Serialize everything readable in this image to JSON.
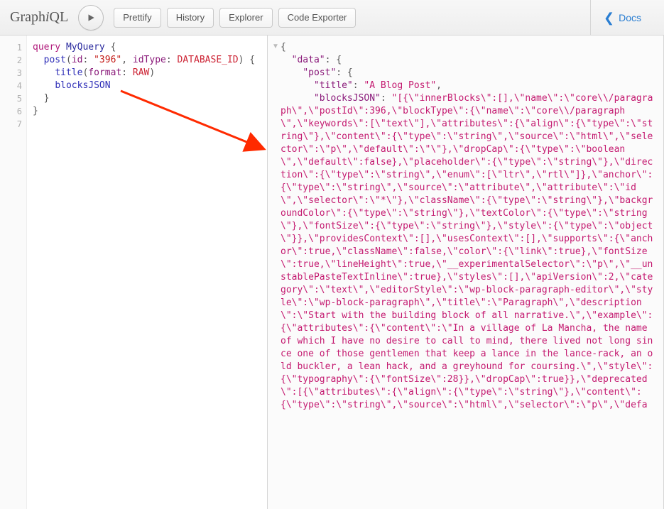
{
  "brand": {
    "pre": "Graph",
    "mid": "i",
    "post": "QL"
  },
  "toolbar": {
    "prettify": "Prettify",
    "history": "History",
    "explorer": "Explorer",
    "exporter": "Code Exporter"
  },
  "docs": {
    "label": "Docs"
  },
  "gutter": [
    "1",
    "2",
    "3",
    "4",
    "5",
    "6",
    "7"
  ],
  "query": {
    "kw": "query",
    "op": "MyQuery",
    "l1_open": " {",
    "l2_field": "post",
    "l2_arg1_name": "id",
    "l2_arg1_val": "\"396\"",
    "l2_arg2_name": "idType",
    "l2_arg2_val": "DATABASE_ID",
    "l2_close": ") {",
    "l3_field": "title",
    "l3_arg_name": "format",
    "l3_arg_val": "RAW",
    "l4_field": "blocksJSON",
    "l5": "  }",
    "l6": "}"
  },
  "result": {
    "open": "{",
    "data_key": "\"data\"",
    "post_key": "\"post\"",
    "title_key": "\"title\"",
    "title_val": "\"A Blog Post\"",
    "blocks_key": "\"blocksJSON\"",
    "blocks_val": "\"[{\\\"innerBlocks\\\":[],\\\"name\\\":\\\"core\\\\/paragraph\\\",\\\"postId\\\":396,\\\"blockType\\\":{\\\"name\\\":\\\"core\\\\/paragraph\\\",\\\"keywords\\\":[\\\"text\\\"],\\\"attributes\\\":{\\\"align\\\":{\\\"type\\\":\\\"string\\\"},\\\"content\\\":{\\\"type\\\":\\\"string\\\",\\\"source\\\":\\\"html\\\",\\\"selector\\\":\\\"p\\\",\\\"default\\\":\\\"\\\"},\\\"dropCap\\\":{\\\"type\\\":\\\"boolean\\\",\\\"default\\\":false},\\\"placeholder\\\":{\\\"type\\\":\\\"string\\\"},\\\"direction\\\":{\\\"type\\\":\\\"string\\\",\\\"enum\\\":[\\\"ltr\\\",\\\"rtl\\\"]},\\\"anchor\\\":{\\\"type\\\":\\\"string\\\",\\\"source\\\":\\\"attribute\\\",\\\"attribute\\\":\\\"id\\\",\\\"selector\\\":\\\"*\\\"},\\\"className\\\":{\\\"type\\\":\\\"string\\\"},\\\"backgroundColor\\\":{\\\"type\\\":\\\"string\\\"},\\\"textColor\\\":{\\\"type\\\":\\\"string\\\"},\\\"fontSize\\\":{\\\"type\\\":\\\"string\\\"},\\\"style\\\":{\\\"type\\\":\\\"object\\\"}},\\\"providesContext\\\":[],\\\"usesContext\\\":[],\\\"supports\\\":{\\\"anchor\\\":true,\\\"className\\\":false,\\\"color\\\":{\\\"link\\\":true},\\\"fontSize\\\":true,\\\"lineHeight\\\":true,\\\"__experimentalSelector\\\":\\\"p\\\",\\\"__unstablePasteTextInline\\\":true},\\\"styles\\\":[],\\\"apiVersion\\\":2,\\\"category\\\":\\\"text\\\",\\\"editorStyle\\\":\\\"wp-block-paragraph-editor\\\",\\\"style\\\":\\\"wp-block-paragraph\\\",\\\"title\\\":\\\"Paragraph\\\",\\\"description\\\":\\\"Start with the building block of all narrative.\\\",\\\"example\\\":{\\\"attributes\\\":{\\\"content\\\":\\\"In a village of La Mancha, the name of which I have no desire to call to mind, there lived not long since one of those gentlemen that keep a lance in the lance-rack, an old buckler, a lean hack, and a greyhound for coursing.\\\",\\\"style\\\":{\\\"typography\\\":{\\\"fontSize\\\":28}},\\\"dropCap\\\":true}},\\\"deprecated\\\":[{\\\"attributes\\\":{\\\"align\\\":{\\\"type\\\":\\\"string\\\"},\\\"content\\\":{\\\"type\\\":\\\"string\\\",\\\"source\\\":\\\"html\\\",\\\"selector\\\":\\\"p\\\",\\\"defa"
  }
}
